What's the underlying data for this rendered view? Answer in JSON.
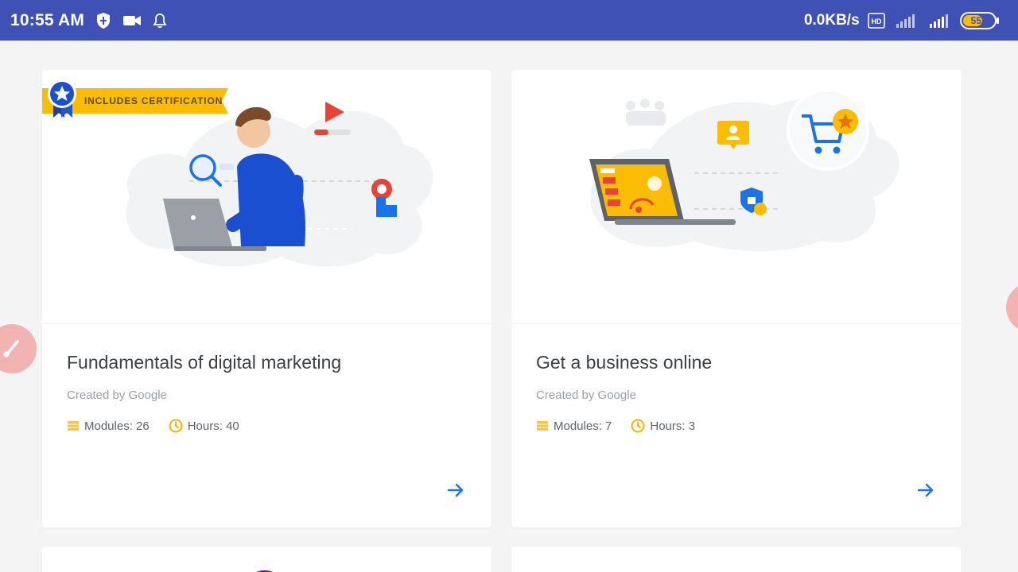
{
  "status_bar": {
    "time": "10:55 AM",
    "net_speed": "0.0KB/s",
    "battery": "55"
  },
  "ribbon_text": "INCLUDES CERTIFICATION",
  "courses": [
    {
      "title": "Fundamentals of digital marketing",
      "creator": "Created by Google",
      "modules": "Modules: 26",
      "hours": "Hours: 40"
    },
    {
      "title": "Get a business online",
      "creator": "Created by Google",
      "modules": "Modules: 7",
      "hours": "Hours: 3"
    }
  ],
  "colors": {
    "status_bar": "#3f51b5",
    "accent_blue": "#1a73e8",
    "ribbon_yellow": "#fbbc04",
    "meta_icon": "#f6c544"
  },
  "icons": [
    "shield-icon",
    "video-icon",
    "bell-icon",
    "hd-icon",
    "signal-icon",
    "battery-icon",
    "arrow-right-icon",
    "modules-icon",
    "clock-icon",
    "certification-badge-icon",
    "brush-icon"
  ]
}
